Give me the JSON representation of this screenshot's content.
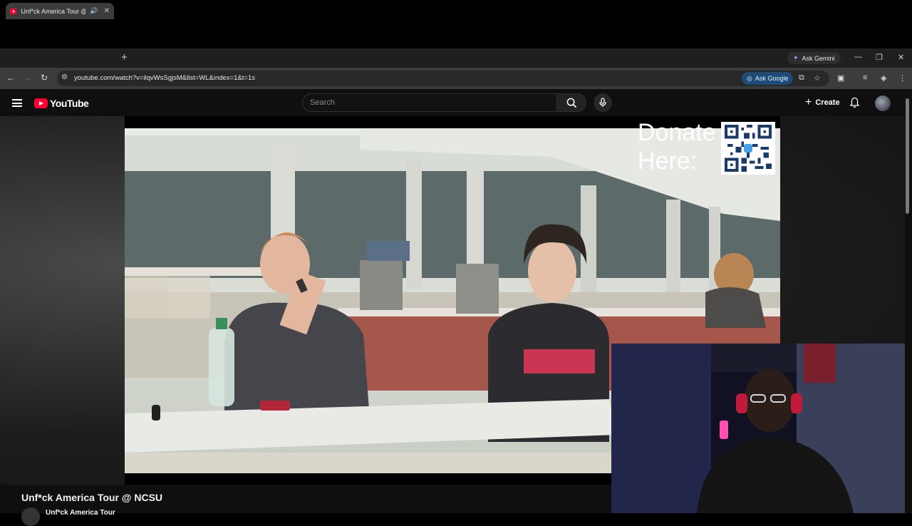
{
  "browser": {
    "tab_title": "Unf*ck America Tour @ NCSU - YouTube",
    "audio_icon": "speaker-icon",
    "new_tab": "+",
    "gemini_label": "Ask Gemini",
    "url": "youtube.com/watch?v=ilqvWsSgjsM&list=WL&index=1&t=1s",
    "ask_google_label": "Ask Google"
  },
  "youtube": {
    "logo_text": "YouTube",
    "search_placeholder": "Search",
    "create_label": "Create"
  },
  "video": {
    "overlay_text": "Donate Here:",
    "title": "Unf*ck America Tour @ NCSU",
    "channel": "Unf*ck America Tour"
  },
  "colors": {
    "youtube_red": "#ff0033",
    "background": "#0f0f0f",
    "chrome_dark": "#3c3c3c"
  }
}
